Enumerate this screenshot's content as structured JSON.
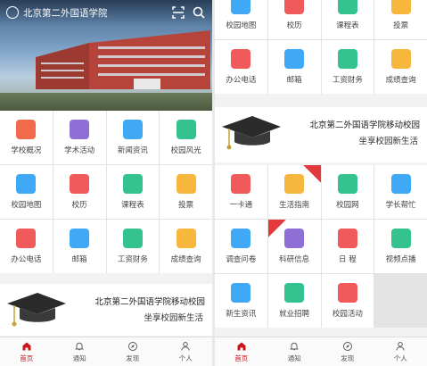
{
  "left": {
    "header_title": "北京第二外国语学院",
    "grid": [
      {
        "label": "学校概况",
        "icon": "building-icon",
        "color": "#f06a4b"
      },
      {
        "label": "学术活动",
        "icon": "document-icon",
        "color": "#8e6fd6"
      },
      {
        "label": "新闻资讯",
        "icon": "news-icon",
        "color": "#3fa9f5"
      },
      {
        "label": "校园风光",
        "icon": "image-icon",
        "color": "#34c38f"
      },
      {
        "label": "校园地图",
        "icon": "map-pin-icon",
        "color": "#3fa9f5"
      },
      {
        "label": "校历",
        "icon": "calendar-icon",
        "color": "#f05a5a"
      },
      {
        "label": "课程表",
        "icon": "books-icon",
        "color": "#34c38f"
      },
      {
        "label": "投票",
        "icon": "vote-icon",
        "color": "#f6b73c"
      },
      {
        "label": "办公电话",
        "icon": "phone-icon",
        "color": "#f05a5a"
      },
      {
        "label": "邮箱",
        "icon": "mail-icon",
        "color": "#3fa9f5"
      },
      {
        "label": "工资财务",
        "icon": "wallet-icon",
        "color": "#34c38f"
      },
      {
        "label": "成绩查询",
        "icon": "report-icon",
        "color": "#f6b73c"
      }
    ],
    "banner_line1": "北京第二外国语学院移动校园",
    "banner_line2": "坐享校园新生活"
  },
  "right": {
    "grid_top": [
      {
        "label": "校园地图",
        "icon": "map-pin-icon",
        "color": "#3fa9f5"
      },
      {
        "label": "校历",
        "icon": "calendar-icon",
        "color": "#f05a5a"
      },
      {
        "label": "课程表",
        "icon": "books-icon",
        "color": "#34c38f"
      },
      {
        "label": "投票",
        "icon": "vote-icon",
        "color": "#f6b73c"
      },
      {
        "label": "办公电话",
        "icon": "phone-icon",
        "color": "#f05a5a"
      },
      {
        "label": "邮箱",
        "icon": "mail-icon",
        "color": "#3fa9f5"
      },
      {
        "label": "工资财务",
        "icon": "wallet-icon",
        "color": "#34c38f"
      },
      {
        "label": "成绩查询",
        "icon": "report-icon",
        "color": "#f6b73c"
      }
    ],
    "banner_line1": "北京第二外国语学院移动校园",
    "banner_line2": "坐享校园新生活",
    "grid_bottom": [
      {
        "label": "一卡通",
        "icon": "card-icon",
        "color": "#f05a5a"
      },
      {
        "label": "生活指南",
        "icon": "basketball-icon",
        "color": "#f6b73c"
      },
      {
        "label": "校园网",
        "icon": "wifi-icon",
        "color": "#34c38f"
      },
      {
        "label": "学长帮忙",
        "icon": "user-icon",
        "color": "#3fa9f5"
      },
      {
        "label": "调查问卷",
        "icon": "survey-icon",
        "color": "#3fa9f5"
      },
      {
        "label": "科研信息",
        "icon": "graduation-icon",
        "color": "#8e6fd6"
      },
      {
        "label": "日 程",
        "icon": "schedule-icon",
        "color": "#f05a5a"
      },
      {
        "label": "视频点播",
        "icon": "video-icon",
        "color": "#34c38f"
      },
      {
        "label": "新生资讯",
        "icon": "headphone-icon",
        "color": "#3fa9f5"
      },
      {
        "label": "就业招聘",
        "icon": "recruit-icon",
        "color": "#34c38f"
      },
      {
        "label": "校园活动",
        "icon": "clover-icon",
        "color": "#f05a5a"
      }
    ]
  },
  "tabbar": [
    {
      "label": "首页",
      "icon": "home-icon"
    },
    {
      "label": "通知",
      "icon": "bell-icon"
    },
    {
      "label": "发现",
      "icon": "compass-icon"
    },
    {
      "label": "个人",
      "icon": "user-icon"
    }
  ],
  "colors": {
    "accent": "#c8161d",
    "badge": "#e4393c"
  }
}
